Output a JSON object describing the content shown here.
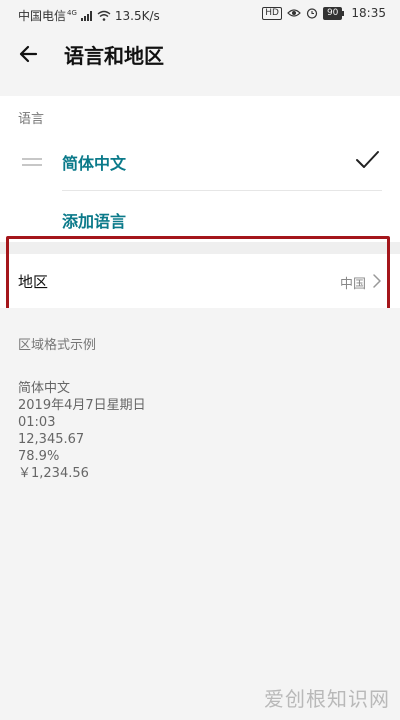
{
  "status_bar": {
    "carrier": "中国电信",
    "network_type": "4G",
    "speed": "13.5K/s",
    "hd_label": "HD",
    "battery": "90",
    "time": "18:35"
  },
  "header": {
    "title": "语言和地区"
  },
  "language_section": {
    "label": "语言",
    "current_language": "简体中文",
    "add_language": "添加语言"
  },
  "region_section": {
    "label": "地区",
    "value": "中国"
  },
  "format_section": {
    "label": "区域格式示例",
    "examples": [
      "简体中文",
      "2019年4月7日星期日",
      "01:03",
      "12,345.67",
      "78.9%",
      "￥1,234.56"
    ]
  },
  "watermark": "爱创根知识网",
  "colors": {
    "accent": "#0b7a8a",
    "highlight": "#a4161b"
  }
}
